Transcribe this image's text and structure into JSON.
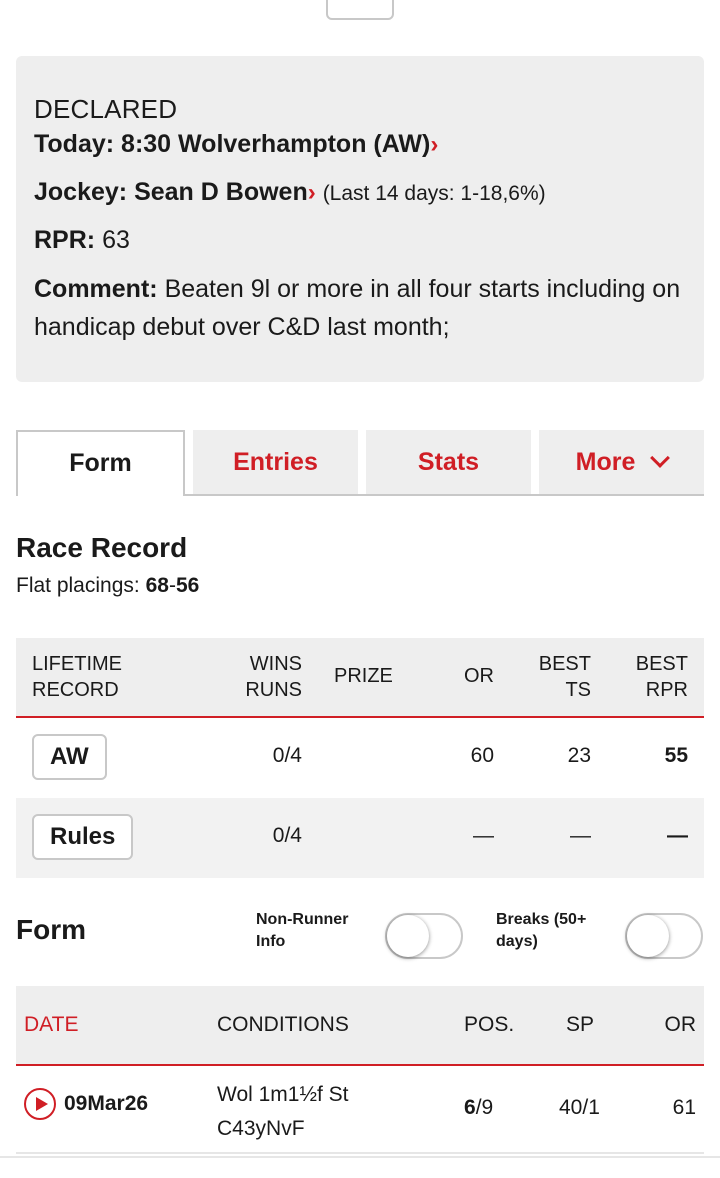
{
  "declared": {
    "label": "DECLARED",
    "today_prefix": "Today:",
    "today_value": "8:30 Wolverhampton (AW)",
    "jockey_prefix": "Jockey:",
    "jockey_value": "Sean D Bowen",
    "jockey_stats": "(Last 14 days: 1-18,6%)",
    "rpr_prefix": "RPR:",
    "rpr_value": "63",
    "comment_prefix": "Comment:",
    "comment_value": "Beaten 9l or more in all four starts including on handicap debut over C&D last month;"
  },
  "tabs": [
    {
      "label": "Form",
      "active": true
    },
    {
      "label": "Entries",
      "active": false
    },
    {
      "label": "Stats",
      "active": false
    },
    {
      "label": "More",
      "active": false
    }
  ],
  "race_record": {
    "title": "Race Record",
    "placings_label": "Flat placings:",
    "placings_a": "68",
    "placings_sep": "-",
    "placings_b": "56"
  },
  "lifetime": {
    "headers": {
      "record_1": "LIFETIME",
      "record_2": "RECORD",
      "wins_1": "WINS",
      "wins_2": "RUNS",
      "prize": "PRIZE",
      "or": "OR",
      "ts_1": "BEST",
      "ts_2": "TS",
      "rpr_1": "BEST",
      "rpr_2": "RPR"
    },
    "rows": [
      {
        "name": "AW",
        "wins_runs": "0/4",
        "prize": "",
        "or": "60",
        "best_ts": "23",
        "best_rpr": "55"
      },
      {
        "name": "Rules",
        "wins_runs": "0/4",
        "prize": "",
        "or": "—",
        "best_ts": "—",
        "best_rpr": "—"
      }
    ]
  },
  "form": {
    "title": "Form",
    "toggle_nonrunner_1": "Non-Runner",
    "toggle_nonrunner_2": "Info",
    "toggle_breaks_1": "Breaks (50+",
    "toggle_breaks_2": "days)",
    "headers": {
      "date": "DATE",
      "conditions": "CONDITIONS",
      "pos": "POS.",
      "sp": "SP",
      "or": "OR"
    },
    "rows": [
      {
        "date": "09Mar26",
        "conditions_1": "Wol 1m1½f St",
        "conditions_2": "C43yNvF",
        "pos": "6",
        "field": "/9",
        "sp": "40/1",
        "or": "61"
      }
    ]
  },
  "colors": {
    "accent": "#d01e25",
    "panel": "#eeeeee",
    "border": "#c8c8c8"
  }
}
